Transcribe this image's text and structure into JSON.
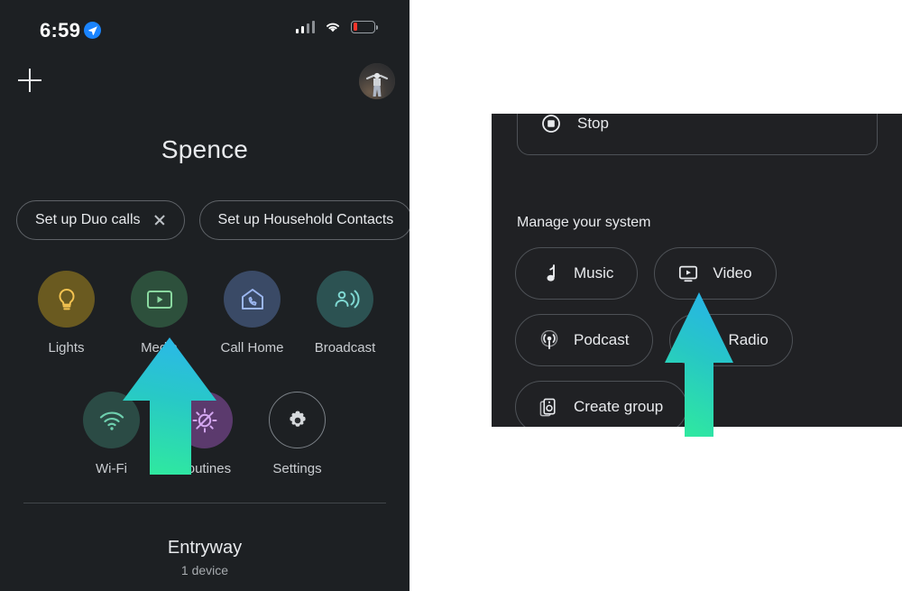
{
  "left_panel": {
    "status_bar": {
      "time": "6:59",
      "location_icon": "location-arrow-icon",
      "signal_icon": "cellular-signal-icon",
      "wifi_icon": "wifi-icon",
      "battery_icon": "battery-low-icon",
      "battery_color": "#f6352b"
    },
    "top_bar": {
      "add_icon": "plus-icon",
      "avatar": "account-avatar"
    },
    "home_title": "Spence",
    "chips": [
      {
        "label": "Set up Duo calls",
        "dismiss_icon": "close-icon",
        "dismissible": true
      },
      {
        "label": "Set up Household Contacts",
        "dismissible": false
      }
    ],
    "actions_row_1": [
      {
        "label": "Lights",
        "icon": "lightbulb-icon",
        "bubble_class": "lights",
        "color": "#f5c451"
      },
      {
        "label": "Media",
        "icon": "media-play-icon",
        "bubble_class": "media",
        "color": "#8ad9a0"
      },
      {
        "label": "Call Home",
        "icon": "home-phone-icon",
        "bubble_class": "callhome",
        "color": "#9bb6f0"
      },
      {
        "label": "Broadcast",
        "icon": "broadcast-icon",
        "bubble_class": "broadcast",
        "color": "#7fd8d2"
      }
    ],
    "actions_row_2": [
      {
        "label": "Wi-Fi",
        "icon": "wifi-icon",
        "bubble_class": "wifi",
        "color": "#6ecfae"
      },
      {
        "label": "Routines",
        "icon": "routines-icon",
        "bubble_class": "routines",
        "color": "#d3a6f0"
      },
      {
        "label": "Settings",
        "icon": "gear-icon",
        "bubble_class": "settings",
        "color": "#d6d9dc"
      }
    ],
    "room": {
      "name": "Entryway",
      "device_count": "1 device"
    }
  },
  "right_panel": {
    "stop_card": {
      "label": "Stop",
      "icon": "stop-circle-icon"
    },
    "section_title": "Manage your system",
    "pills": [
      {
        "label": "Music",
        "icon": "music-note-icon"
      },
      {
        "label": "Video",
        "icon": "video-monitor-icon"
      },
      {
        "label": "Podcast",
        "icon": "podcast-icon"
      },
      {
        "label": "Radio",
        "icon": "radio-icon"
      },
      {
        "label": "Create group",
        "icon": "speaker-group-icon"
      }
    ]
  },
  "annotations": {
    "arrow_left": {
      "name": "pointer-arrow-media",
      "gradient_top": "#2bb8e8",
      "gradient_bottom": "#2fe8a0"
    },
    "arrow_right": {
      "name": "pointer-arrow-video",
      "gradient_top": "#27b4e6",
      "gradient_bottom": "#2fe8a0"
    }
  }
}
